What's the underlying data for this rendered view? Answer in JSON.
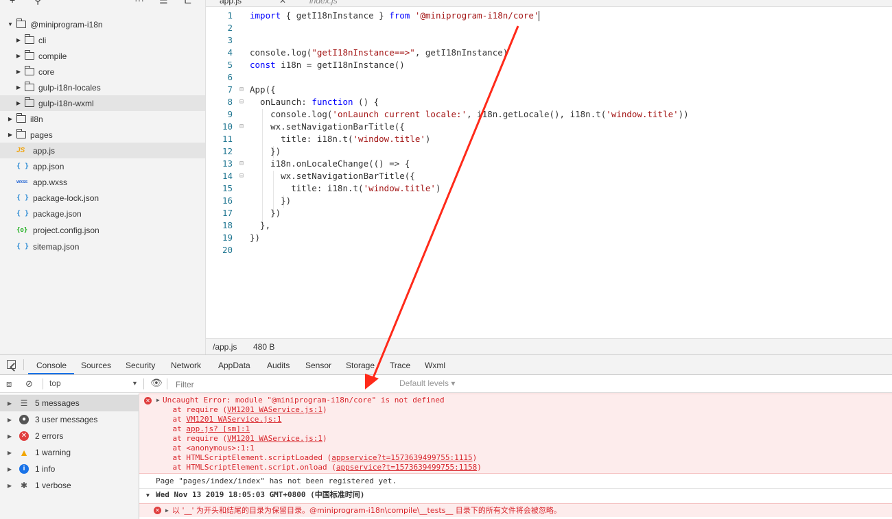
{
  "sidebar": {
    "items": [
      {
        "label": "@miniprogram-i18n",
        "type": "folder",
        "expanded": true,
        "depth": 0
      },
      {
        "label": "cli",
        "type": "folder",
        "depth": 1
      },
      {
        "label": "compile",
        "type": "folder",
        "depth": 1
      },
      {
        "label": "core",
        "type": "folder",
        "depth": 1
      },
      {
        "label": "gulp-i18n-locales",
        "type": "folder",
        "depth": 1
      },
      {
        "label": "gulp-i18n-wxml",
        "type": "folder",
        "depth": 1
      },
      {
        "label": "il8n",
        "type": "folder",
        "depth": 0
      },
      {
        "label": "pages",
        "type": "folder",
        "depth": 0
      },
      {
        "label": "app.js",
        "type": "js",
        "depth": 0,
        "icon": "JS"
      },
      {
        "label": "app.json",
        "type": "json",
        "depth": 0,
        "icon": "{ }"
      },
      {
        "label": "app.wxss",
        "type": "wxss",
        "depth": 0,
        "icon": "wxss"
      },
      {
        "label": "package-lock.json",
        "type": "json",
        "depth": 0,
        "icon": "{ }"
      },
      {
        "label": "package.json",
        "type": "json",
        "depth": 0,
        "icon": "{ }"
      },
      {
        "label": "project.config.json",
        "type": "config",
        "depth": 0,
        "icon": "{o}"
      },
      {
        "label": "sitemap.json",
        "type": "json",
        "depth": 0,
        "icon": "{ }"
      }
    ]
  },
  "editor": {
    "tabs": [
      {
        "label": "app.js",
        "active": true
      },
      {
        "label": "index.js",
        "active": false
      }
    ],
    "close_glyph": "✕",
    "lines": [
      "1",
      "2",
      "3",
      "4",
      "5",
      "6",
      "7",
      "8",
      "9",
      "10",
      "11",
      "12",
      "13",
      "14",
      "15",
      "16",
      "17",
      "18",
      "19",
      "20"
    ],
    "status_path": "/app.js",
    "status_size": "480 B"
  },
  "devtools": {
    "tabs": [
      "Console",
      "Sources",
      "Security",
      "Network",
      "AppData",
      "Audits",
      "Sensor",
      "Storage",
      "Trace",
      "Wxml"
    ],
    "context": "top",
    "filter_placeholder": "Filter",
    "levels": "Default levels ▾",
    "categories": [
      {
        "label": "5 messages",
        "icon": "list"
      },
      {
        "label": "3 user messages",
        "icon": "user"
      },
      {
        "label": "2 errors",
        "icon": "error"
      },
      {
        "label": "1 warning",
        "icon": "warning"
      },
      {
        "label": "1 info",
        "icon": "info"
      },
      {
        "label": "1 verbose",
        "icon": "bug"
      }
    ],
    "console": {
      "error_title": "Uncaught Error: module \"@miniprogram-i18n/core\" is not defined",
      "stack": [
        {
          "pre": "    at require (",
          "link": "VM1201 WAService.js:1",
          "post": ")"
        },
        {
          "pre": "    at ",
          "link": "VM1201 WAService.js:1",
          "post": ""
        },
        {
          "pre": "    at ",
          "link": "app.js? [sm]:1",
          "post": ""
        },
        {
          "pre": "    at require (",
          "link": "VM1201 WAService.js:1",
          "post": ")"
        },
        {
          "pre": "    at <anonymous>:1:1",
          "link": "",
          "post": ""
        },
        {
          "pre": "    at HTMLScriptElement.scriptLoaded (",
          "link": "appservice?t=1573639499755:1115",
          "post": ")"
        },
        {
          "pre": "    at HTMLScriptElement.script.onload (",
          "link": "appservice?t=1573639499755:1158",
          "post": ")"
        }
      ],
      "page_msg": "Page \"pages/index/index\" has not been registered yet.",
      "group": "Wed Nov 13 2019 18:05:03 GMT+0800 (中国标准时间)",
      "warn_msg": "以 '__' 为开头和结尾的目录为保留目录。@miniprogram-i18n\\compile\\__tests__ 目录下的所有文件将会被忽略。"
    }
  },
  "colors": {
    "keyword": "#0000ff",
    "string": "#a31515",
    "error": "#d8262c",
    "annotation_arrow": "#ff2a1a"
  }
}
